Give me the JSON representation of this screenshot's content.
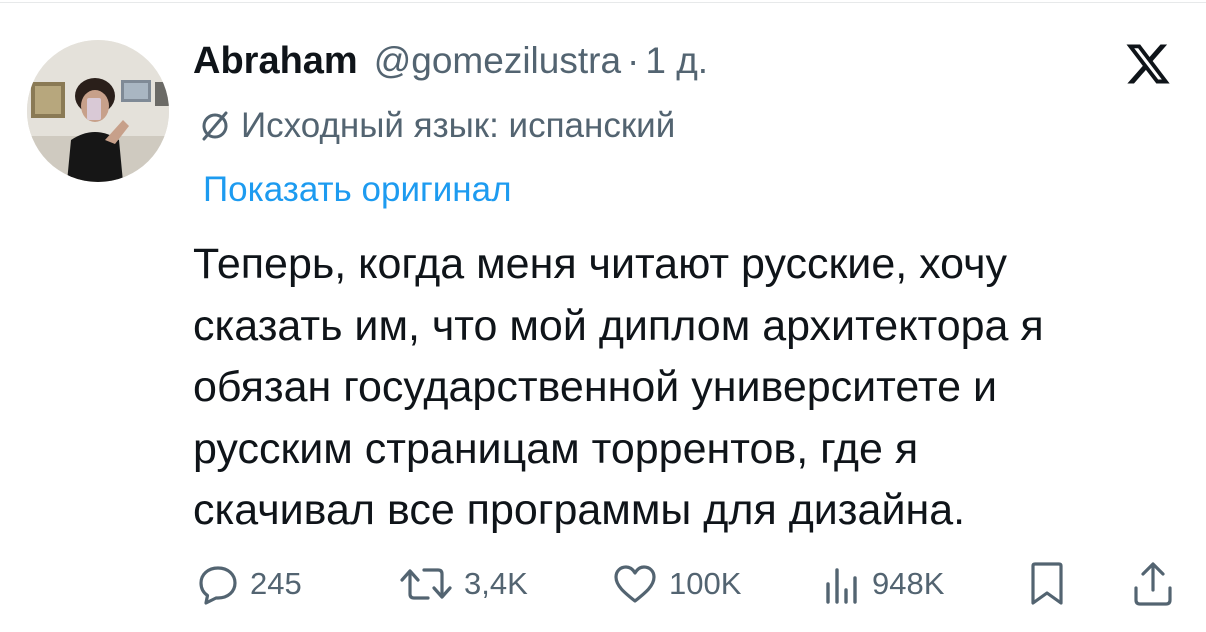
{
  "tweet": {
    "author_name": "Abraham",
    "author_handle": "@gomezilustra",
    "separator": "·",
    "timestamp": "1 д.",
    "translation_note": "Исходный язык: испанский",
    "show_original_label": "Показать оригинал",
    "body_lines": [
      "Теперь, когда меня читают русские, хочу",
      "сказать им, что мой диплом архитектора я",
      "обязан государственной университете и",
      "русским страницам торрентов, где я",
      "скачивал все программы для дизайна."
    ]
  },
  "actions": {
    "replies": "245",
    "retweets": "3,4K",
    "likes": "100K",
    "views": "948K"
  },
  "icons": {
    "logo": "x-logo-icon",
    "translate": "translate-icon",
    "reply": "reply-icon",
    "retweet": "retweet-icon",
    "like": "heart-icon",
    "views": "views-icon",
    "bookmark": "bookmark-icon",
    "share": "share-icon"
  },
  "colors": {
    "text": "#0f1419",
    "secondary": "#536471",
    "link": "#1d9bf0"
  }
}
